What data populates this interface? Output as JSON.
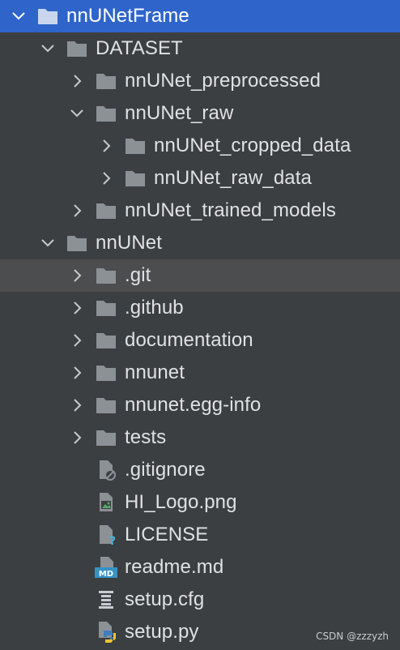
{
  "tree": [
    {
      "label": "nnUNetFrame",
      "depth": 0,
      "chevron": "down",
      "icon": "folder-icon",
      "selected": true
    },
    {
      "label": "DATASET",
      "depth": 1,
      "chevron": "down",
      "icon": "folder-icon"
    },
    {
      "label": "nnUNet_preprocessed",
      "depth": 2,
      "chevron": "right",
      "icon": "folder-icon"
    },
    {
      "label": "nnUNet_raw",
      "depth": 2,
      "chevron": "down",
      "icon": "folder-icon"
    },
    {
      "label": "nnUNet_cropped_data",
      "depth": 3,
      "chevron": "right",
      "icon": "folder-icon"
    },
    {
      "label": "nnUNet_raw_data",
      "depth": 3,
      "chevron": "right",
      "icon": "folder-icon"
    },
    {
      "label": "nnUNet_trained_models",
      "depth": 2,
      "chevron": "right",
      "icon": "folder-icon"
    },
    {
      "label": "nnUNet",
      "depth": 1,
      "chevron": "down",
      "icon": "folder-icon"
    },
    {
      "label": ".git",
      "depth": 2,
      "chevron": "right",
      "icon": "folder-icon",
      "hover": true
    },
    {
      "label": ".github",
      "depth": 2,
      "chevron": "right",
      "icon": "folder-icon"
    },
    {
      "label": "documentation",
      "depth": 2,
      "chevron": "right",
      "icon": "folder-icon"
    },
    {
      "label": "nnunet",
      "depth": 2,
      "chevron": "right",
      "icon": "folder-icon"
    },
    {
      "label": "nnunet.egg-info",
      "depth": 2,
      "chevron": "right",
      "icon": "folder-icon"
    },
    {
      "label": "tests",
      "depth": 2,
      "chevron": "right",
      "icon": "folder-icon"
    },
    {
      "label": ".gitignore",
      "depth": 2,
      "chevron": "none",
      "icon": "ignored-file-icon"
    },
    {
      "label": "HI_Logo.png",
      "depth": 2,
      "chevron": "none",
      "icon": "image-file-icon"
    },
    {
      "label": "LICENSE",
      "depth": 2,
      "chevron": "none",
      "icon": "unknown-file-icon"
    },
    {
      "label": "readme.md",
      "depth": 2,
      "chevron": "none",
      "icon": "markdown-file-icon"
    },
    {
      "label": "setup.cfg",
      "depth": 2,
      "chevron": "none",
      "icon": "config-file-icon"
    },
    {
      "label": "setup.py",
      "depth": 2,
      "chevron": "none",
      "icon": "python-file-icon"
    }
  ],
  "markdown_badge": "MD",
  "watermark": "CSDN @zzzyzh",
  "colors": {
    "background": "#3c3f41",
    "selection": "#2f65ca",
    "hover": "#4b4d4f",
    "text": "#dfe1e5",
    "folder": "#8c9196"
  }
}
